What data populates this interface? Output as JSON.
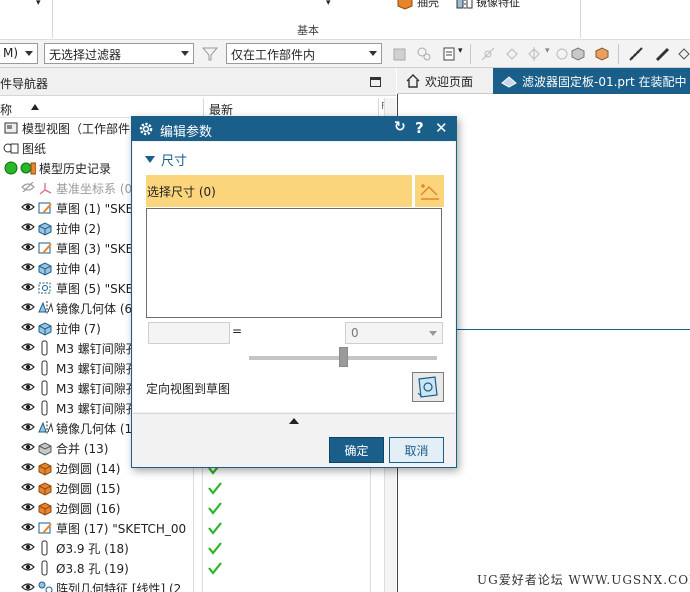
{
  "ribbon": {
    "group_label": "基本",
    "shell_label": "抽壳",
    "mirror_feature_label": "镜像特征"
  },
  "toolbar": {
    "mode_partial": "M)",
    "filter_select": "无选择过滤器",
    "scope_select": "仅在工作部件内"
  },
  "navigator": {
    "title": "件导航器",
    "col_name": "称",
    "col_latest": "最新",
    "col_right": "F",
    "rows": [
      {
        "label": "模型视图（工作部件",
        "icon": "model-view-icon",
        "eye": false,
        "gray": false,
        "check": false
      },
      {
        "label": "图纸",
        "icon": "drawing-icon",
        "eye": false,
        "gray": false,
        "check": false
      },
      {
        "label": "模型历史记录",
        "icon": "history-icon",
        "eye": false,
        "gray": false,
        "check": false
      },
      {
        "label": "基准坐标系 (0",
        "icon": "datum-csys-icon",
        "eye": "hidden",
        "gray": true,
        "check": false
      },
      {
        "label": "草图 (1) \"SKE",
        "icon": "sketch-icon",
        "eye": true,
        "gray": false,
        "check": false
      },
      {
        "label": "拉伸 (2)",
        "icon": "extrude-icon",
        "eye": true,
        "gray": false,
        "check": false
      },
      {
        "label": "草图 (3) \"SKE",
        "icon": "sketch-icon",
        "eye": true,
        "gray": false,
        "check": false
      },
      {
        "label": "拉伸 (4)",
        "icon": "extrude-icon",
        "eye": true,
        "gray": false,
        "check": false
      },
      {
        "label": "草图 (5) \"SKE",
        "icon": "sketch-dashed-icon",
        "eye": true,
        "gray": false,
        "check": false
      },
      {
        "label": "镜像几何体 (6",
        "icon": "mirror-geometry-icon",
        "eye": true,
        "gray": false,
        "check": false
      },
      {
        "label": "拉伸 (7)",
        "icon": "extrude-icon",
        "eye": true,
        "gray": false,
        "check": false
      },
      {
        "label": "M3 螺钉间隙孔",
        "icon": "hole-icon",
        "eye": true,
        "gray": false,
        "check": false
      },
      {
        "label": "M3 螺钉间隙孔",
        "icon": "hole-icon",
        "eye": true,
        "gray": false,
        "check": false
      },
      {
        "label": "M3 螺钉间隙孔",
        "icon": "hole-icon",
        "eye": true,
        "gray": false,
        "check": false
      },
      {
        "label": "M3 螺钉间隙孔",
        "icon": "hole-icon",
        "eye": true,
        "gray": false,
        "check": false
      },
      {
        "label": "镜像几何体 (1",
        "icon": "mirror-geometry-icon",
        "eye": true,
        "gray": false,
        "check": false
      },
      {
        "label": "合并 (13)",
        "icon": "unite-icon",
        "eye": true,
        "gray": false,
        "check": false
      },
      {
        "label": "边倒圆 (14)",
        "icon": "edge-blend-icon",
        "eye": true,
        "gray": false,
        "check": true
      },
      {
        "label": "边倒圆 (15)",
        "icon": "edge-blend-icon",
        "eye": true,
        "gray": false,
        "check": true
      },
      {
        "label": "边倒圆 (16)",
        "icon": "edge-blend-icon",
        "eye": true,
        "gray": false,
        "check": true
      },
      {
        "label": "草图 (17) \"SKETCH_00",
        "icon": "sketch-icon",
        "eye": true,
        "gray": false,
        "check": true
      },
      {
        "label": "Ø3.9 孔 (18)",
        "icon": "hole-icon",
        "eye": true,
        "gray": false,
        "check": true
      },
      {
        "label": "Ø3.8 孔 (19)",
        "icon": "hole-icon",
        "eye": true,
        "gray": false,
        "check": true
      },
      {
        "label": "阵列几何特征 [线性] (2",
        "icon": "pattern-feature-icon",
        "eye": true,
        "gray": false,
        "check": false
      }
    ]
  },
  "tabs": {
    "welcome": "欢迎页面",
    "part": "滤波器固定板-01.prt 在装配中"
  },
  "dialog": {
    "title": "编辑参数",
    "section": "尺寸",
    "select_dimension": "选择尺寸 (0)",
    "equals": "=",
    "value": "0",
    "orient_label": "定向视图到草图",
    "ok": "确定",
    "cancel": "取消"
  },
  "watermark": "UG爱好者论坛 WWW.UGSNX.COM",
  "colors": {
    "accent": "#1a5e8a",
    "selection_highlight": "#fbd57c",
    "check_green": "#2ab52a",
    "orange": "#e8842a"
  }
}
